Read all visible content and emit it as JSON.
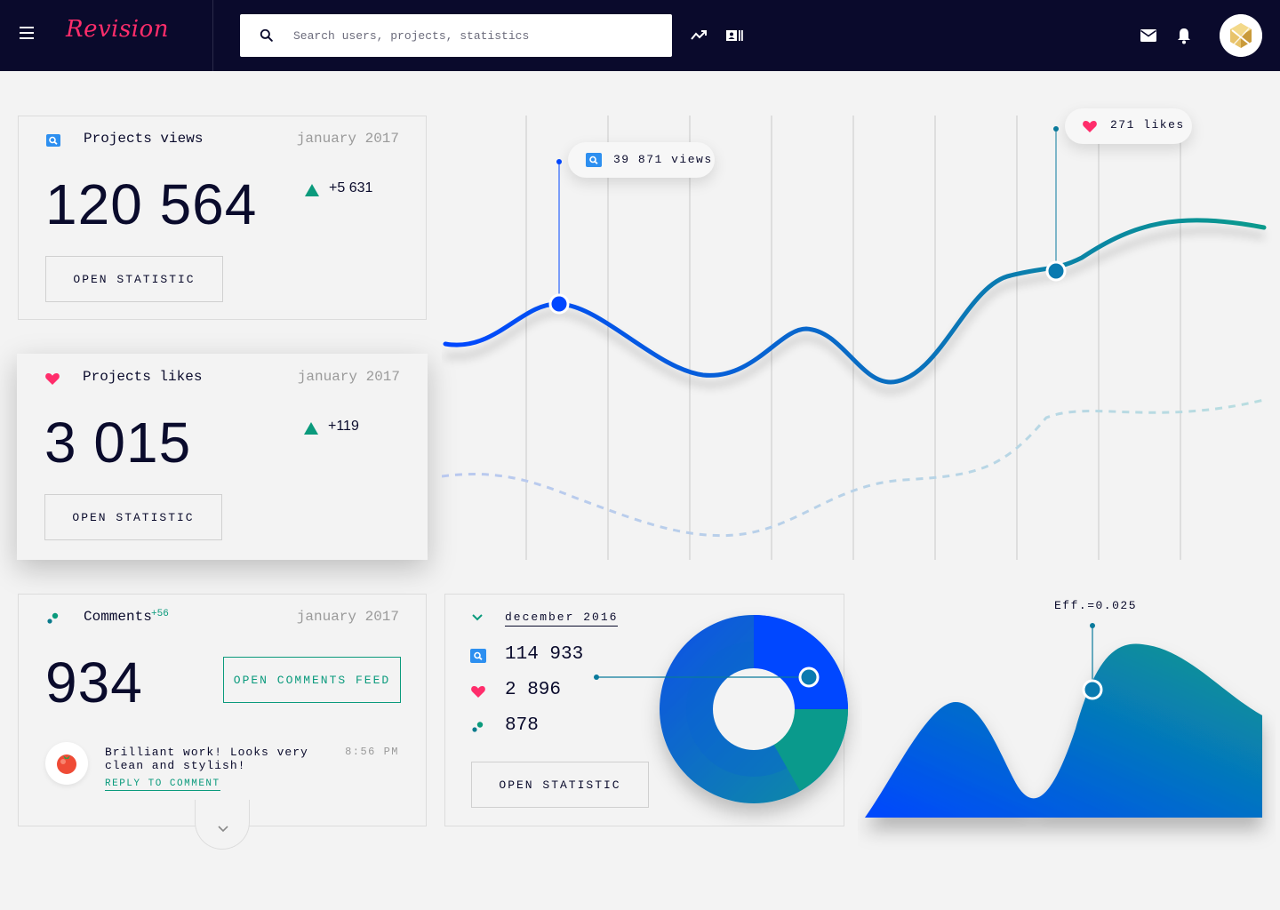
{
  "app": {
    "logo": "Revision"
  },
  "search": {
    "placeholder": "Search users, projects, statistics"
  },
  "icons": {
    "menu": "menu-icon",
    "search": "search-icon",
    "trending": "trending-icon",
    "cards": "contacts-icon",
    "mail": "mail-icon",
    "bell": "bell-icon"
  },
  "colors": {
    "accent": "#ff2d6b",
    "teal": "#0a9a7c",
    "blue": "#0047ff",
    "navy": "#0a0a2c"
  },
  "views_card": {
    "title": "Projects views",
    "date": "january 2017",
    "value": "120 564",
    "delta": "+5 631",
    "button": "OPEN STATISTIC"
  },
  "likes_card": {
    "title": "Projects likes",
    "date": "january 2017",
    "value": "3 015",
    "delta": "+119",
    "button": "OPEN STATISTIC"
  },
  "comments_card": {
    "title": "Comments",
    "badge": "+56",
    "date": "january 2017",
    "value": "934",
    "button": "OPEN COMMENTS FEED",
    "comment": {
      "text_line1": "Brilliant work! Looks very",
      "text_line2": "clean and stylish!",
      "time": "8:56 PM",
      "reply": "REPLY TO COMMENT"
    }
  },
  "line_chart": {
    "tooltip_views": "39 871 views",
    "tooltip_likes": "271 likes"
  },
  "donut_card": {
    "period": "december 2016",
    "rows": [
      {
        "icon": "search-icon",
        "value": "114 933"
      },
      {
        "icon": "heart-icon",
        "value": "2 896"
      },
      {
        "icon": "comments-icon",
        "value": "878"
      }
    ],
    "button": "OPEN STATISTIC"
  },
  "area_chart": {
    "label": "Eff.=0.025"
  }
}
